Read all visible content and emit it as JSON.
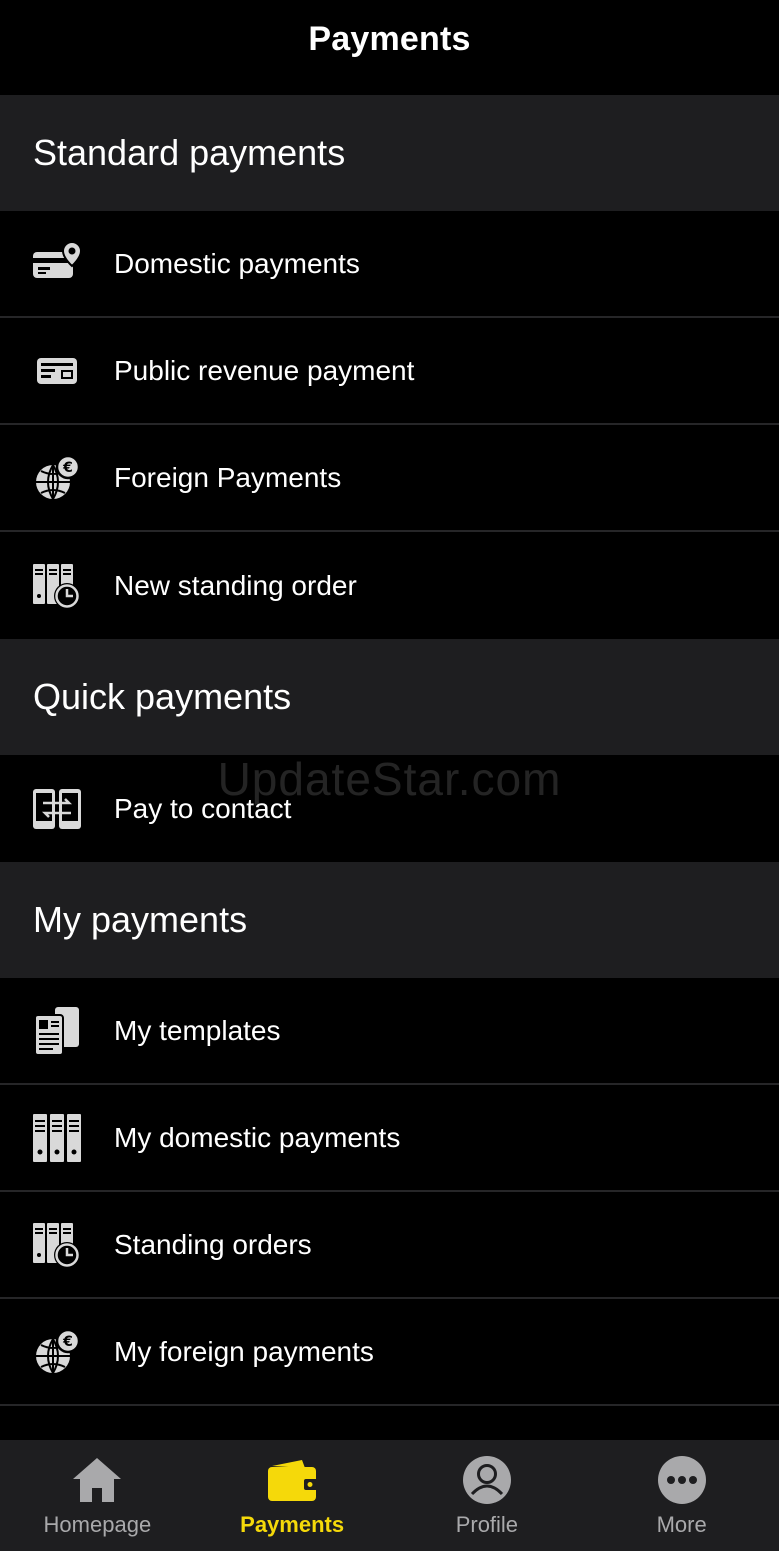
{
  "header": {
    "title": "Payments"
  },
  "watermark": "UpdateStar.com",
  "sections": [
    {
      "title": "Standard payments",
      "items": [
        {
          "label": "Domestic payments",
          "icon": "card-pin-icon"
        },
        {
          "label": "Public revenue payment",
          "icon": "card-icon"
        },
        {
          "label": "Foreign Payments",
          "icon": "globe-euro-icon"
        },
        {
          "label": "New standing order",
          "icon": "binders-clock-icon"
        }
      ]
    },
    {
      "title": "Quick payments",
      "items": [
        {
          "label": "Pay to contact",
          "icon": "phones-transfer-icon"
        }
      ]
    },
    {
      "title": "My payments",
      "items": [
        {
          "label": "My templates",
          "icon": "templates-icon"
        },
        {
          "label": "My domestic payments",
          "icon": "binders-icon"
        },
        {
          "label": "Standing orders",
          "icon": "binders-clock-icon"
        },
        {
          "label": "My foreign payments",
          "icon": "globe-euro-icon"
        }
      ]
    }
  ],
  "tabbar": {
    "tabs": [
      {
        "label": "Homepage",
        "icon": "home-icon",
        "active": false
      },
      {
        "label": "Payments",
        "icon": "wallet-icon",
        "active": true
      },
      {
        "label": "Profile",
        "icon": "profile-icon",
        "active": false
      },
      {
        "label": "More",
        "icon": "more-icon",
        "active": false
      }
    ],
    "active_color": "#f5d90a",
    "inactive_color": "#a9a9ab"
  }
}
